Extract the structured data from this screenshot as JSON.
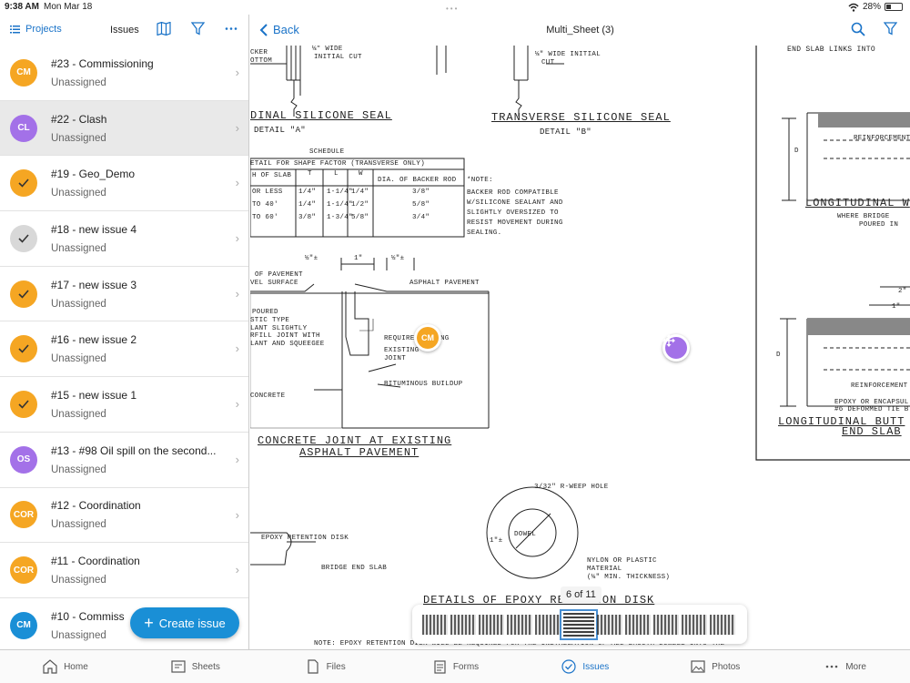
{
  "status": {
    "time": "9:38 AM",
    "date": "Mon Mar 18",
    "battery": "28%",
    "battery_level": 0.28
  },
  "sidebar": {
    "projects_label": "Projects",
    "title": "Issues",
    "create_label": "Create issue",
    "issues": [
      {
        "initials": "CM",
        "color": "#f5a623",
        "name": "#23 - Commissioning",
        "assignee": "Unassigned",
        "selected": false
      },
      {
        "initials": "CL",
        "color": "#a371e8",
        "name": "#22 - Clash",
        "assignee": "Unassigned",
        "selected": true
      },
      {
        "initials": "",
        "icon": "check-icon",
        "color": "#f5a623",
        "name": "#19 - Geo_Demo",
        "assignee": "Unassigned",
        "selected": false
      },
      {
        "initials": "",
        "icon": "check-icon",
        "color": "#d8d8d8",
        "name": "#18 - new issue 4",
        "assignee": "Unassigned",
        "selected": false
      },
      {
        "initials": "",
        "icon": "check-icon",
        "color": "#f5a623",
        "name": "#17 - new issue 3",
        "assignee": "Unassigned",
        "selected": false
      },
      {
        "initials": "",
        "icon": "check-icon",
        "color": "#f5a623",
        "name": "#16 - new issue 2",
        "assignee": "Unassigned",
        "selected": false
      },
      {
        "initials": "",
        "icon": "check-icon",
        "color": "#f5a623",
        "name": "#15 - new issue 1",
        "assignee": "Unassigned",
        "selected": false
      },
      {
        "initials": "OS",
        "color": "#a371e8",
        "name": "#13 - #98 Oil spill on the second...",
        "assignee": "Unassigned",
        "selected": false
      },
      {
        "initials": "COR",
        "color": "#f5a623",
        "name": "#12 - Coordination",
        "assignee": "Unassigned",
        "selected": false
      },
      {
        "initials": "COR",
        "color": "#f5a623",
        "name": "#11 - Coordination",
        "assignee": "Unassigned",
        "selected": false
      },
      {
        "initials": "CM",
        "color": "#1a8fd6",
        "name": "#10 - Commiss",
        "assignee": "Unassigned",
        "selected": false
      }
    ]
  },
  "viewer": {
    "back_label": "Back",
    "sheet_title": "Multi_Sheet (3)",
    "page_indicator": "6 of 11",
    "pin_label": "CM",
    "drawing_text": {
      "wide_cut_a": "⅛\" WIDE",
      "initial_cut_a": "INITIAL CUT",
      "cker": "CKER",
      "ottom": "OTTOM",
      "wide_initial_b": "⅛\" WIDE INITIAL",
      "cut_b": "CUT",
      "title_a": "DINAL SILICONE SEAL",
      "detail_a": "DETAIL \"A\"",
      "title_b": "TRANSVERSE SILICONE SEAL",
      "detail_b": "DETAIL \"B\"",
      "schedule": "SCHEDULE",
      "schedule_sub": "ETAIL FOR SHAPE FACTOR (TRANSVERSE ONLY)",
      "col_slab": "H OF SLAB",
      "col_t": "T",
      "col_l": "L",
      "col_w": "W",
      "col_dia": "DIA. OF BACKER ROD",
      "rows": [
        [
          "OR LESS",
          "1/4\"",
          "1-1/4\"",
          "1/4\"",
          "3/8\""
        ],
        [
          "TO 40'",
          "1/4\"",
          "1-1/4\"",
          "1/2\"",
          "5/8\""
        ],
        [
          "TO 60'",
          "3/8\"",
          "1-3/4\"",
          "5/8\"",
          "3/4\""
        ]
      ],
      "note": "*NOTE:",
      "note_lines": [
        "BACKER ROD COMPATIBLE",
        "W/SILICONE SEALANT AND",
        "SLIGHTLY OVERSIZED TO",
        "RESIST MOVEMENT DURING",
        "SEALING."
      ],
      "dim_half": "½\"±",
      "dim_one": "1\"",
      "of_pavement": "OF PAVEMENT",
      "vel_surface": "VEL SURFACE",
      "asphalt_pavement": "ASPHALT PAVEMENT",
      "poured": "POURED",
      "stic_type": "STIC TYPE",
      "lant_slightly": "LANT SLIGHTLY",
      "rfill_joint": "RFILL JOINT WITH",
      "lant_squeegee": "LANT AND SQUEEGEE",
      "require": "REQUIRE",
      "ng": "NG",
      "existing": "EXISTING",
      "joint": "JOINT",
      "concrete": "CONCRETE",
      "bituminous": "BITUMINOUS BUILDUP",
      "title_concrete_1": "CONCRETE JOINT AT EXISTING",
      "title_concrete_2": "ASPHALT PAVEMENT",
      "reinforcement_1": "REINFORCEMENT",
      "title_long_w": "LONGITUDINAL W",
      "where_bridge": "WHERE BRIDGE",
      "poured_in": "POURED IN",
      "dim_d": "D",
      "dim_two": "2\"",
      "dim_one_b": "1\"",
      "reinforcement_2": "REINFORCEMENT",
      "epoxy_encaps": "EPOXY OR ENCAPSUL",
      "deformed_tie": "#6 DEFORMED TIE B",
      "title_long_butt": "LONGITUDINAL BUTT",
      "end_slab": "END SLAB",
      "weep_hole": "3/32\" R-WEEP HOLE",
      "dowel": "DOWEL",
      "dim_one_pm": "1\"±",
      "epoxy_retention": "EPOXY RETENTION DISK",
      "bridge_end_slab": "BRIDGE END SLAB",
      "nylon": "NYLON OR PLASTIC",
      "material": "MATERIAL",
      "min_thick": "(⅛\" MIN. THICKNESS)",
      "title_epoxy_disk": "DETAILS OF EPOXY RETENTION DISK",
      "bottom_note": "NOTE: EPOXY RETENTION DISK WILL BE REQUIRED FOR THE INSTALLATION OF ALL SMOOTH DOWELS INTO THE",
      "top_right_fragment": "END SLAB LINKS INTO"
    }
  },
  "tabs": [
    {
      "label": "Home",
      "icon": "home-icon",
      "active": false
    },
    {
      "label": "Sheets",
      "icon": "sheets-icon",
      "active": false
    },
    {
      "label": "Files",
      "icon": "files-icon",
      "active": false
    },
    {
      "label": "Forms",
      "icon": "forms-icon",
      "active": false
    },
    {
      "label": "Issues",
      "icon": "issues-icon",
      "active": true
    },
    {
      "label": "Photos",
      "icon": "photos-icon",
      "active": false
    },
    {
      "label": "More",
      "icon": "more-icon",
      "active": false
    }
  ],
  "colors": {
    "accent": "#1a73c8",
    "button": "#1a8fd6",
    "orange": "#f5a623",
    "purple": "#a371e8"
  }
}
